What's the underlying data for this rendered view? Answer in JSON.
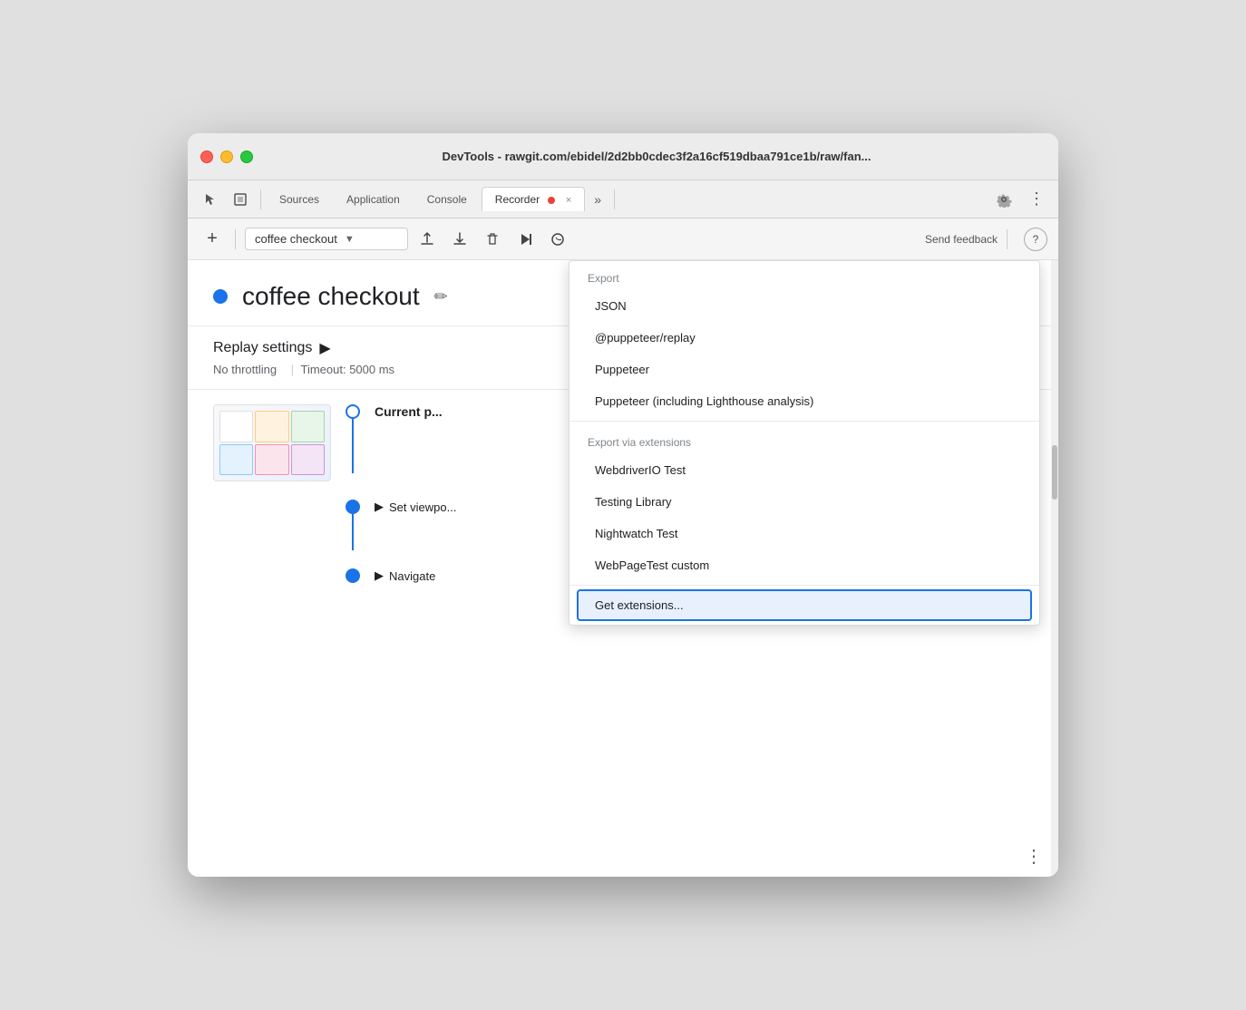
{
  "window": {
    "title": "DevTools - rawgit.com/ebidel/2d2bb0cdec3f2a16cf519dbaa791ce1b/raw/fan..."
  },
  "tabs": {
    "items": [
      {
        "label": "Sources",
        "active": false
      },
      {
        "label": "Application",
        "active": false
      },
      {
        "label": "Console",
        "active": false
      },
      {
        "label": "Recorder",
        "active": true
      },
      {
        "label": "»",
        "active": false
      }
    ],
    "recorder_close": "×"
  },
  "toolbar": {
    "add_label": "+",
    "recording_name": "coffee checkout",
    "send_feedback": "Send feedback",
    "help": "?"
  },
  "recording": {
    "title": "coffee checkout",
    "dot_color": "#1a73e8"
  },
  "replay_settings": {
    "label": "Replay settings",
    "arrow": "▶",
    "no_throttling": "No throttling",
    "timeout": "Timeout: 5000 ms"
  },
  "steps": {
    "current_page_label": "Current p...",
    "set_viewport_label": "Set viewpo...",
    "navigate_label": "Navigate"
  },
  "dropdown": {
    "export_label": "Export",
    "items_export": [
      {
        "label": "JSON"
      },
      {
        "label": "@puppeteer/replay"
      },
      {
        "label": "Puppeteer"
      },
      {
        "label": "Puppeteer (including Lighthouse analysis)"
      }
    ],
    "export_via_extensions_label": "Export via extensions",
    "items_extensions": [
      {
        "label": "WebdriverIO Test"
      },
      {
        "label": "Testing Library"
      },
      {
        "label": "Nightwatch Test"
      },
      {
        "label": "WebPageTest custom"
      }
    ],
    "get_extensions_label": "Get extensions..."
  }
}
